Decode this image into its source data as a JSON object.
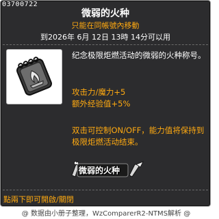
{
  "item": {
    "id": "03700722",
    "title": "微弱的火种",
    "subtitle": "只能在同帳號內移動",
    "expiry": "到2026年 6月 12日 13時 14分可以用"
  },
  "description": {
    "main": "纪念极限炬燃活动的微弱的火种称号。",
    "stats": [
      "攻击力/魔力+5",
      "额外经验值+5%"
    ],
    "note": "双击可控制ON/OFF，能力值将保持到极限炬燃活动结束。"
  },
  "nameplate": {
    "text": "微弱的火种"
  },
  "footer": {
    "text": "點兩下即可開啟/關閉"
  },
  "credit": "@ 数据由小册子整理，WzComparerR2-NTMS解析 @",
  "icon": {
    "name": "title-medal-icon"
  },
  "colors": {
    "panel_bg": "#2c2c2e",
    "accent_orange": "#ffaa11",
    "text_white": "#ffffff"
  }
}
